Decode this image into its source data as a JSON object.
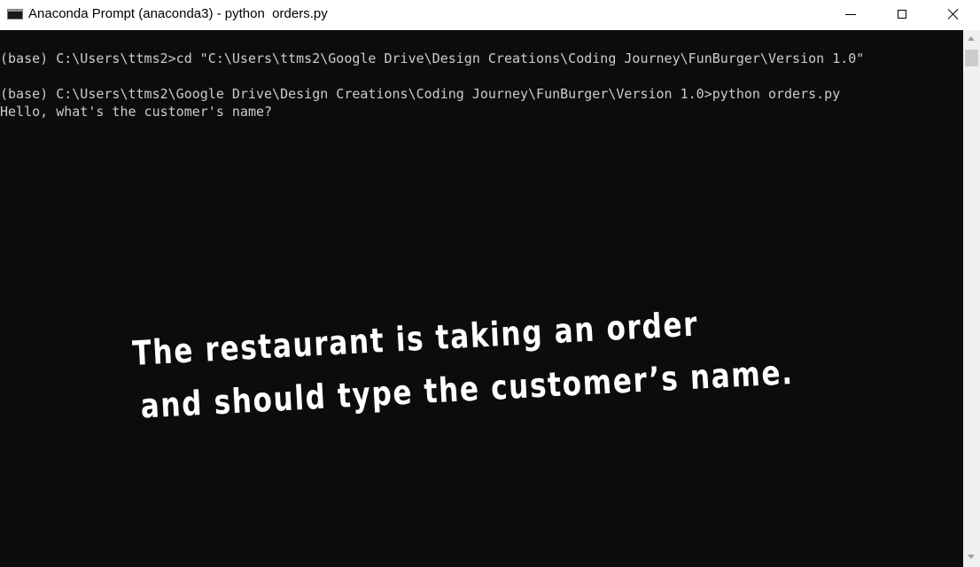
{
  "window": {
    "title": "Anaconda Prompt (anaconda3) - python  orders.py",
    "icon": "console-icon",
    "controls": {
      "minimize_icon": "minimize-icon",
      "maximize_icon": "maximize-icon",
      "close_icon": "close-icon"
    }
  },
  "console": {
    "background_color": "#0c0c0c",
    "text_color": "#cccccc",
    "lines": [
      "(base) C:\\Users\\ttms2>cd \"C:\\Users\\ttms2\\Google Drive\\Design Creations\\Coding Journey\\FunBurger\\Version 1.0\"",
      "(base) C:\\Users\\ttms2\\Google Drive\\Design Creations\\Coding Journey\\FunBurger\\Version 1.0>python orders.py",
      "Hello, what's the customer's name?"
    ]
  },
  "overlay": {
    "line1": "The restaurant is taking an order",
    "line2": "and should type the customer’s name."
  },
  "scrollbar": {
    "up_icon": "scroll-up-arrow-icon",
    "down_icon": "scroll-down-arrow-icon"
  }
}
